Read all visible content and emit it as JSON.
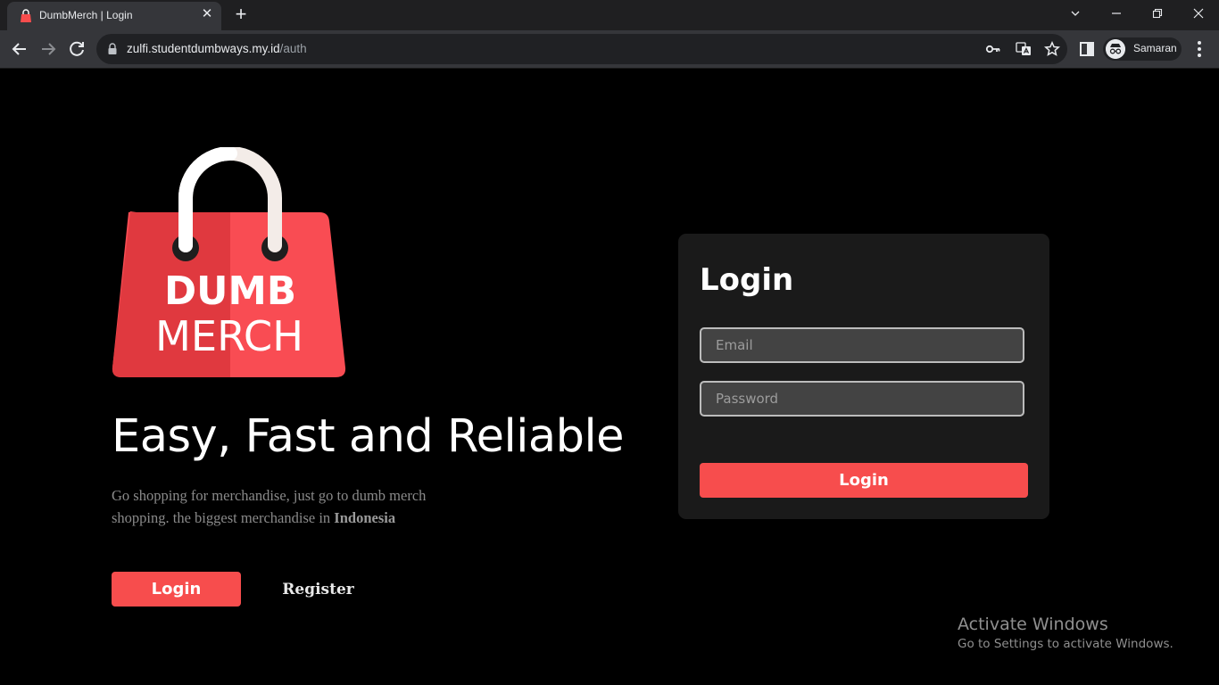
{
  "browser": {
    "tab_title": "DumbMerch | Login",
    "tab_close": "✕",
    "new_tab": "+",
    "url_host": "zulfi.studentdumbways.my.id",
    "url_path": "/auth",
    "profile_label": "Samaran",
    "window_controls": {
      "dropdown": "⌄",
      "minimize": "—",
      "restore": "❐",
      "close": "✕"
    }
  },
  "logo": {
    "line1": "DUMB",
    "line2": "MERCH"
  },
  "hero": {
    "headline": "Easy, Fast and Reliable",
    "description_prefix": "Go shopping for merchandise, just go to dumb merch shopping. the biggest merchandise in ",
    "description_bold": "Indonesia",
    "login_button": "Login",
    "register_button": "Register"
  },
  "login_card": {
    "title": "Login",
    "email_placeholder": "Email",
    "password_placeholder": "Password",
    "submit_label": "Login"
  },
  "watermark": {
    "title": "Activate Windows",
    "subtitle": "Go to Settings to activate Windows."
  },
  "colors": {
    "accent": "#f74d4d",
    "card_bg": "#1a1a1a",
    "page_bg": "#000000"
  },
  "icons": [
    "favicon-bag-icon",
    "back-arrow-icon",
    "forward-arrow-icon",
    "reload-icon",
    "lock-icon",
    "key-icon",
    "translate-icon",
    "star-icon",
    "sidepanel-icon",
    "incognito-icon",
    "menu-dots-icon"
  ]
}
